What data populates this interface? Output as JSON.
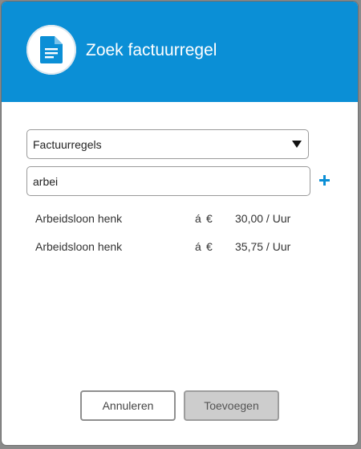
{
  "dialog": {
    "title": "Zoek factuurregel",
    "header_color": "#0b8fd6",
    "icon": "document-icon"
  },
  "filter": {
    "selected": "Factuurregels"
  },
  "search": {
    "value": "arbei",
    "add_icon": "plus-icon"
  },
  "results": [
    {
      "name": "Arbeidsloon henk",
      "a": "á",
      "currency": "€",
      "price": "30,00 / Uur"
    },
    {
      "name": "Arbeidsloon henk",
      "a": "á",
      "currency": "€",
      "price": "35,75 / Uur"
    }
  ],
  "buttons": {
    "cancel": "Annuleren",
    "add": "Toevoegen"
  }
}
